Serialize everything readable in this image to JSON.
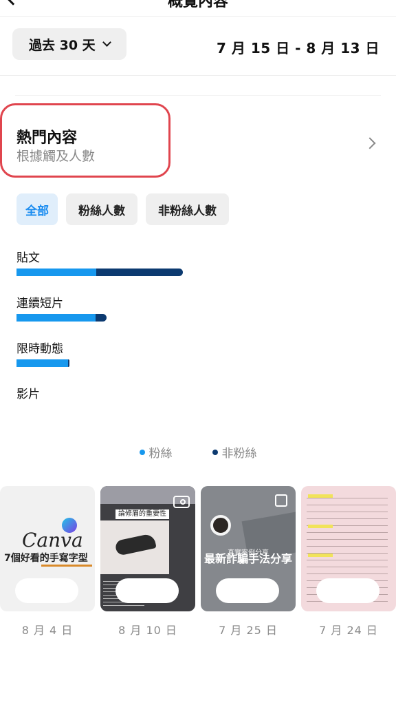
{
  "header": {
    "title": "概覽內容"
  },
  "range": {
    "button_label": "過去 30 天",
    "dates": "7 月 15 日 - 8 月 13 日"
  },
  "section": {
    "title": "熱門內容",
    "subtitle": "根據觸及人數"
  },
  "filters": [
    {
      "label": "全部",
      "active": true
    },
    {
      "label": "粉絲人數",
      "active": false
    },
    {
      "label": "非粉絲人數",
      "active": false
    }
  ],
  "metrics": [
    {
      "label": "貼文",
      "followers": 0.48,
      "non_followers": 0.52
    },
    {
      "label": "連續短片",
      "followers": 0.88,
      "non_followers": 0.12
    },
    {
      "label": "限時動態",
      "followers": 0.99,
      "non_followers": 0.01
    },
    {
      "label": "影片",
      "followers": 0,
      "non_followers": 0
    }
  ],
  "legend": [
    {
      "label": "粉絲",
      "color": "#1798ee"
    },
    {
      "label": "非粉絲",
      "color": "#0c3a70"
    }
  ],
  "thumbnails": [
    {
      "date": "8 月 4 日",
      "title": "Canva",
      "subtitle": "7個好看的手寫字型"
    },
    {
      "date": "8 月 10 日",
      "tag": "論修眉的重要性",
      "icon": "video-camera-icon"
    },
    {
      "date": "7 月 25 日",
      "small_text": "真實案例分享",
      "title": "最新詐騙手法分享",
      "icon": "copy-icon"
    },
    {
      "date": "7 月 24 日"
    }
  ]
}
